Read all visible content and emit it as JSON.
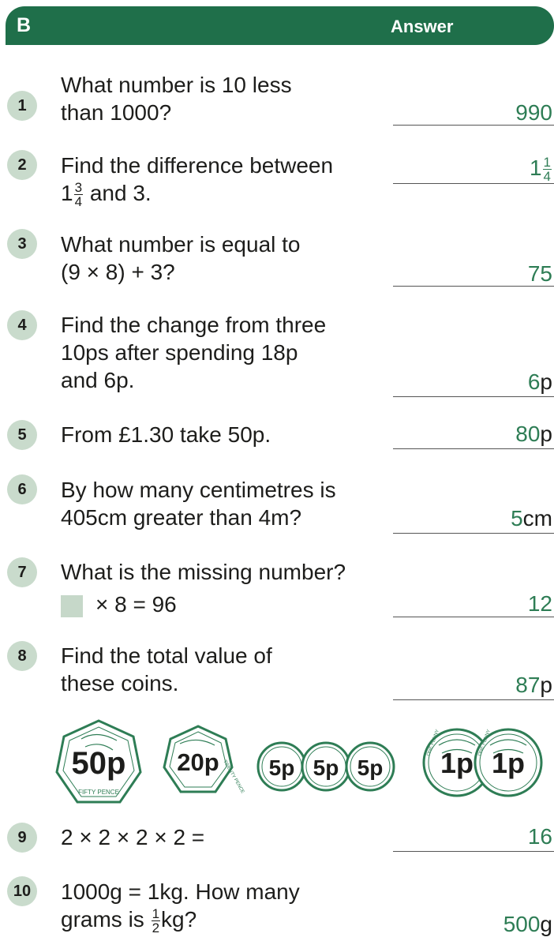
{
  "header": {
    "section": "B",
    "answer_label": "Answer"
  },
  "questions": [
    {
      "number": "1",
      "line1": "What number is 10 less",
      "line2": "than 1000?",
      "answer": "990"
    },
    {
      "number": "2",
      "line1": "Find the difference between",
      "mixed_whole": "1",
      "mixed_num": "3",
      "mixed_den": "4",
      "line2_rest": " and 3.",
      "answer_whole": "1",
      "answer_num": "1",
      "answer_den": "4"
    },
    {
      "number": "3",
      "line1": "What number is equal to",
      "line2": "(9 × 8) + 3?",
      "answer": "75"
    },
    {
      "number": "4",
      "line1": "Find the change from three",
      "line2": "10ps after spending 18p",
      "line3": "and 6p.",
      "answer": "6",
      "unit": "p"
    },
    {
      "number": "5",
      "line1": "From £1.30 take 50p.",
      "answer": "80",
      "unit": "p"
    },
    {
      "number": "6",
      "line1": "By how many centimetres is",
      "line2": "405cm greater than 4m?",
      "answer": "5",
      "unit": "cm"
    },
    {
      "number": "7",
      "line1": "What is the missing number?",
      "line2": "× 8 = 96",
      "answer": "12"
    },
    {
      "number": "8",
      "line1": "Find the total value of",
      "line2": "these coins.",
      "answer": "87",
      "unit": "p"
    },
    {
      "number": "9",
      "line1": "2 × 2 × 2 × 2 =",
      "answer": "16"
    },
    {
      "number": "10",
      "line1": "1000g = 1kg. How many",
      "line2_pre": "grams is ",
      "frac_num": "1",
      "frac_den": "2",
      "line2_post": "kg?",
      "answer": "500",
      "unit": "g"
    }
  ],
  "coins": [
    {
      "label": "50p",
      "rim_text": "FIFTY PENCE"
    },
    {
      "label": "20p",
      "rim_text": "TWENTY PENCE"
    },
    {
      "label": "5p"
    },
    {
      "label": "5p"
    },
    {
      "label": "5p"
    },
    {
      "label": "1p",
      "rim_text": "ONE PENNY"
    },
    {
      "label": "1p",
      "rim_text": "ONE PENNY"
    }
  ],
  "colors": {
    "header_bg": "#1f6f4a",
    "number_bg": "#c9dbcc",
    "answer_text": "#2e7d55",
    "coin_stroke": "#2e7d55",
    "coin_fill": "#ffffff"
  }
}
